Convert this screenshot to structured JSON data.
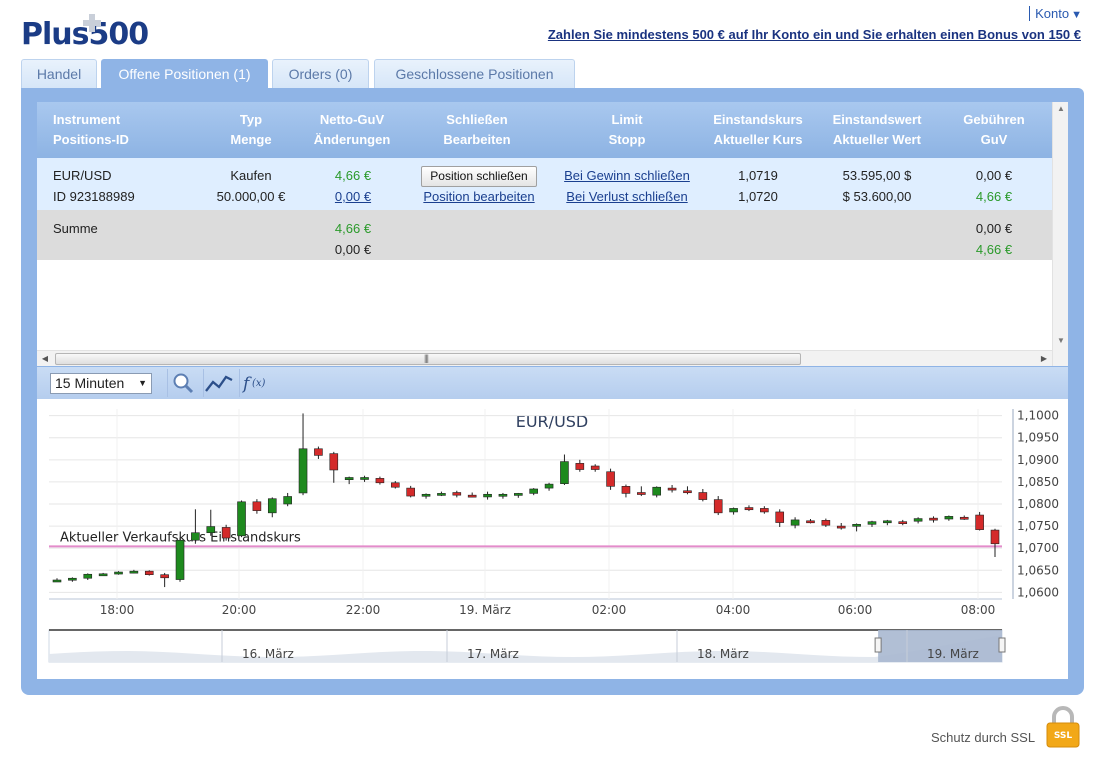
{
  "header": {
    "konto_label": "Konto",
    "promo_text": "Zahlen Sie mindestens 500 € auf Ihr Konto ein und Sie erhalten einen Bonus von 150 €",
    "logo_text": "Plus500"
  },
  "tabs": [
    {
      "label": "Handel",
      "active": false
    },
    {
      "label": "Offene Positionen (1)",
      "active": true
    },
    {
      "label": "Orders (0)",
      "active": false
    },
    {
      "label": "Geschlossene Positionen",
      "active": false
    }
  ],
  "table": {
    "columns": [
      {
        "line1": "Instrument",
        "line2": "Positions-ID"
      },
      {
        "line1": "Typ",
        "line2": "Menge"
      },
      {
        "line1": "Netto-GuV",
        "line2": "Änderungen"
      },
      {
        "line1": "Schließen",
        "line2": "Bearbeiten"
      },
      {
        "line1": "Limit",
        "line2": "Stopp"
      },
      {
        "line1": "Einstandskurs",
        "line2": "Aktueller Kurs"
      },
      {
        "line1": "Einstandswert",
        "line2": "Aktueller Wert"
      },
      {
        "line1": "Gebühren",
        "line2": "GuV"
      }
    ],
    "row": {
      "instrument": "EUR/USD",
      "position_id": "ID 923188989",
      "type": "Kaufen",
      "amount": "50.000,00 €",
      "net_pnl": "4,66 €",
      "changes": "0,00 €",
      "close_button": "Position schließen",
      "edit_link": "Position bearbeiten",
      "limit_link": "Bei Gewinn schließen",
      "stop_link": "Bei Verlust schließen",
      "entry_rate": "1,0719",
      "current_rate": "1,0720",
      "entry_value": "53.595,00 $",
      "current_value": "$ 53.600,00",
      "fees": "0,00 €",
      "pnl": "4,66 €"
    },
    "summary": {
      "label": "Summe",
      "net_pnl": "4,66 €",
      "changes": "0,00 €",
      "fees": "0,00 €",
      "pnl": "4,66 €"
    }
  },
  "toolbar": {
    "timeframe": "15 Minuten",
    "buttons": [
      "zoom-icon",
      "line-chart-icon",
      "function-icon"
    ]
  },
  "chart_data": {
    "type": "candlestick",
    "title": "EUR/USD",
    "y_ticks": [
      "1,1000",
      "1,0950",
      "1,0900",
      "1,0850",
      "1,0800",
      "1,0750",
      "1,0700",
      "1,0650",
      "1,0600"
    ],
    "ylim": [
      1.0585,
      1.1015
    ],
    "x_ticks": [
      "18:00",
      "20:00",
      "22:00",
      "19. März",
      "02:00",
      "04:00",
      "06:00",
      "08:00"
    ],
    "reference_line": {
      "value": 1.0704,
      "label": "Aktueller Verkaufskurs  Einstandskurs",
      "color": "#e38ccb"
    },
    "colors": {
      "up": "#1e8a1e",
      "down": "#d42a2a"
    },
    "candles": [
      [
        1.0628,
        1.0632,
        1.0624,
        1.0628
      ],
      [
        1.0628,
        1.0634,
        1.0624,
        1.0632
      ],
      [
        1.0632,
        1.0643,
        1.0628,
        1.0641
      ],
      [
        1.0641,
        1.0644,
        1.0638,
        1.0642
      ],
      [
        1.0642,
        1.0648,
        1.064,
        1.0646
      ],
      [
        1.0646,
        1.0651,
        1.0643,
        1.0648
      ],
      [
        1.0648,
        1.065,
        1.0638,
        1.064
      ],
      [
        1.064,
        1.0644,
        1.0612,
        1.0633
      ],
      [
        1.0629,
        1.0724,
        1.0624,
        1.0718
      ],
      [
        1.0718,
        1.0788,
        1.071,
        1.0735
      ],
      [
        1.0735,
        1.0787,
        1.0728,
        1.0749
      ],
      [
        1.0747,
        1.0753,
        1.0717,
        1.0723
      ],
      [
        1.0728,
        1.0808,
        1.0725,
        1.0805
      ],
      [
        1.0805,
        1.0811,
        1.0778,
        1.0785
      ],
      [
        1.078,
        1.0815,
        1.077,
        1.0812
      ],
      [
        1.08,
        1.0825,
        1.0795,
        1.0817
      ],
      [
        1.0825,
        1.1005,
        1.082,
        1.0925
      ],
      [
        1.0925,
        1.093,
        1.0902,
        1.091
      ],
      [
        1.0914,
        1.0918,
        1.0848,
        1.0877
      ],
      [
        1.0855,
        1.0862,
        1.0845,
        1.086
      ],
      [
        1.0856,
        1.0864,
        1.085,
        1.086
      ],
      [
        1.0858,
        1.0862,
        1.0844,
        1.0848
      ],
      [
        1.0848,
        1.0852,
        1.0835,
        1.0838
      ],
      [
        1.0836,
        1.0841,
        1.0815,
        1.0818
      ],
      [
        1.0818,
        1.0824,
        1.0812,
        1.0822
      ],
      [
        1.0822,
        1.0828,
        1.0818,
        1.0824
      ],
      [
        1.0826,
        1.083,
        1.0815,
        1.082
      ],
      [
        1.082,
        1.0826,
        1.0815,
        1.0817
      ],
      [
        1.0816,
        1.0828,
        1.081,
        1.0822
      ],
      [
        1.0818,
        1.0825,
        1.0812,
        1.0822
      ],
      [
        1.082,
        1.0825,
        1.0814,
        1.0824
      ],
      [
        1.0824,
        1.0836,
        1.082,
        1.0834
      ],
      [
        1.0836,
        1.0848,
        1.083,
        1.0845
      ],
      [
        1.0846,
        1.0912,
        1.0843,
        1.0896
      ],
      [
        1.0892,
        1.09,
        1.0873,
        1.0878
      ],
      [
        1.0886,
        1.089,
        1.0873,
        1.0878
      ],
      [
        1.0873,
        1.088,
        1.0832,
        1.084
      ],
      [
        1.084,
        1.0844,
        1.0815,
        1.0824
      ],
      [
        1.0826,
        1.084,
        1.0818,
        1.0822
      ],
      [
        1.082,
        1.084,
        1.0815,
        1.0838
      ],
      [
        1.0836,
        1.0843,
        1.0826,
        1.0833
      ],
      [
        1.083,
        1.084,
        1.0822,
        1.0826
      ],
      [
        1.0826,
        1.0834,
        1.0806,
        1.081
      ],
      [
        1.081,
        1.0818,
        1.0775,
        1.078
      ],
      [
        1.0782,
        1.0792,
        1.0776,
        1.079
      ],
      [
        1.0792,
        1.0797,
        1.0784,
        1.0787
      ],
      [
        1.079,
        1.0795,
        1.0778,
        1.0782
      ],
      [
        1.0782,
        1.0788,
        1.0748,
        1.0758
      ],
      [
        1.0752,
        1.077,
        1.0745,
        1.0764
      ],
      [
        1.0762,
        1.0766,
        1.0756,
        1.076
      ],
      [
        1.0763,
        1.0767,
        1.0748,
        1.0752
      ],
      [
        1.075,
        1.0757,
        1.0742,
        1.0749
      ],
      [
        1.0752,
        1.0756,
        1.0738,
        1.0754
      ],
      [
        1.0754,
        1.0762,
        1.0748,
        1.076
      ],
      [
        1.076,
        1.0764,
        1.0752,
        1.0762
      ],
      [
        1.076,
        1.0764,
        1.0752,
        1.0758
      ],
      [
        1.0761,
        1.077,
        1.0756,
        1.0767
      ],
      [
        1.0768,
        1.0772,
        1.0758,
        1.0764
      ],
      [
        1.0766,
        1.0774,
        1.0762,
        1.0772
      ],
      [
        1.077,
        1.0774,
        1.0764,
        1.0768
      ],
      [
        1.0775,
        1.0782,
        1.074,
        1.0742
      ],
      [
        1.0741,
        1.0744,
        1.068,
        1.071
      ]
    ],
    "navigator": {
      "labels": [
        "16. März",
        "17. März",
        "18. März",
        "19. März"
      ],
      "selected_from": 0.87,
      "selected_to": 1.0
    }
  }
}
